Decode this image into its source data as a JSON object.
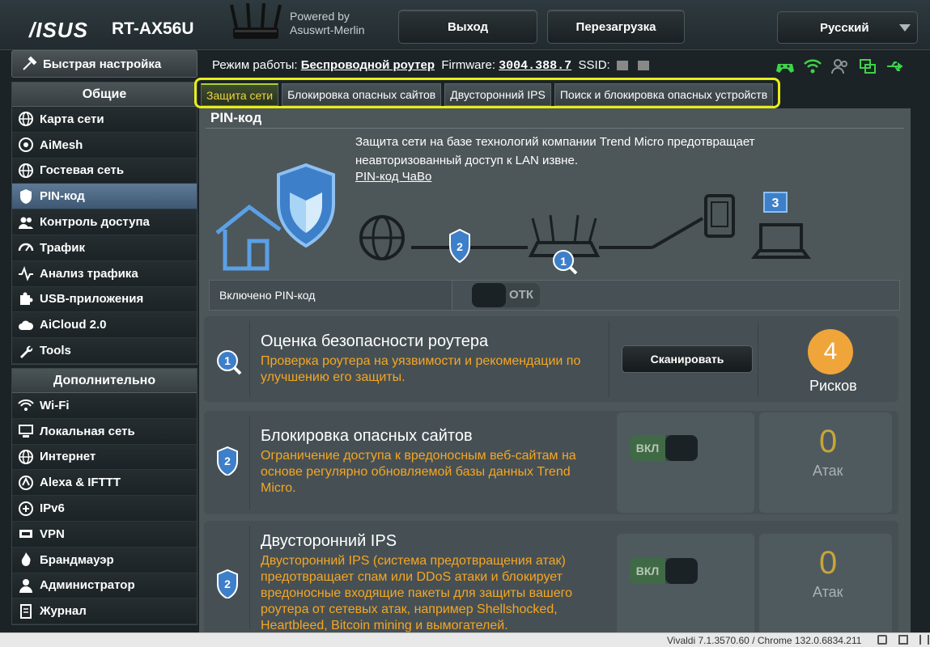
{
  "header": {
    "brand": "/ISUS",
    "model": "RT-AX56U",
    "powered_line1": "Powered by",
    "powered_line2": "Asuswrt-Merlin",
    "logout_label": "Выход",
    "reboot_label": "Перезагрузка",
    "language": "Русский"
  },
  "status": {
    "mode_label": "Режим работы:",
    "mode_value": "Беспроводной роутер",
    "fw_label": "Firmware:",
    "fw_value": "3004.388.7",
    "ssid_label": "SSID:"
  },
  "sidebar": {
    "quick_setup": "Быстрая настройка",
    "general_header": "Общие",
    "general_items": [
      {
        "label": "Карта сети",
        "icon": "globe-icon"
      },
      {
        "label": "AiMesh",
        "icon": "aimesh-icon"
      },
      {
        "label": "Гостевая сеть",
        "icon": "globe-icon"
      },
      {
        "label": "PIN-код",
        "icon": "shield-icon"
      },
      {
        "label": "Контроль доступа",
        "icon": "users-icon"
      },
      {
        "label": "Трафик",
        "icon": "gauge-icon"
      },
      {
        "label": "Анализ трафика",
        "icon": "pulse-icon"
      },
      {
        "label": "USB-приложения",
        "icon": "puzzle-icon"
      },
      {
        "label": "AiCloud 2.0",
        "icon": "cloud-icon"
      },
      {
        "label": "Tools",
        "icon": "wrench-icon"
      }
    ],
    "advanced_header": "Дополнительно",
    "advanced_items": [
      {
        "label": "Wi-Fi",
        "icon": "wifi-icon"
      },
      {
        "label": "Локальная сеть",
        "icon": "lan-icon"
      },
      {
        "label": "Интернет",
        "icon": "globe-icon"
      },
      {
        "label": "Alexa & IFTTT",
        "icon": "alexa-icon"
      },
      {
        "label": "IPv6",
        "icon": "ipv6-icon"
      },
      {
        "label": "VPN",
        "icon": "vpn-icon"
      },
      {
        "label": "Брандмауэр",
        "icon": "firewall-icon"
      },
      {
        "label": "Администратор",
        "icon": "admin-icon"
      },
      {
        "label": "Журнал",
        "icon": "log-icon"
      }
    ]
  },
  "tabs": [
    {
      "label": "Защита сети",
      "active": true
    },
    {
      "label": "Блокировка опасных сайтов",
      "active": false
    },
    {
      "label": "Двусторонний IPS",
      "active": false
    },
    {
      "label": "Поиск и блокировка опасных устройств",
      "active": false
    }
  ],
  "main": {
    "title": "PIN-код",
    "description": "Защита сети на базе технологий компании Trend Micro предотвращает неавторизованный доступ к LAN извне.",
    "faq_link": "PIN-код ЧаВо",
    "pin_toggle_label": "Включено PIN-код",
    "pin_toggle_state": "ОТК",
    "diagram_badges": [
      "2",
      "1",
      "3"
    ],
    "cards": [
      {
        "number": "1",
        "title": "Оценка безопасности роутера",
        "text": "Проверка роутера на уязвимости и рекомендации по улучшению его защиты.",
        "button": "Сканировать",
        "risk_count": "4",
        "risk_label": "Рисков"
      },
      {
        "number": "2",
        "title": "Блокировка опасных сайтов",
        "text": "Ограничение доступа к вредоносным веб-сайтам на основе регулярно обновляемой базы данных Trend Micro.",
        "toggle": "ВКЛ",
        "count": "0",
        "count_label": "Атак"
      },
      {
        "number": "2",
        "title": "Двусторонний IPS",
        "text": "Двусторонний IPS (система предотвращения атак) предотвращает спам или DDoS атаки и блокирует вредоносные входящие пакеты для защиты вашего роутера от сетевых атак, например Shellshocked, Heartbleed, Bitcoin mining и вымогателей.",
        "toggle": "ВКЛ",
        "count": "0",
        "count_label": "Атак"
      }
    ]
  },
  "bottom": {
    "version": "Vivaldi 7.1.3570.60 / Chrome 132.0.6834.211"
  },
  "colors": {
    "tab_highlight": "#e7ed1a",
    "orange_text": "#f5a623",
    "risk_badge": "#f0a53a",
    "status_green": "#3fd24a"
  }
}
